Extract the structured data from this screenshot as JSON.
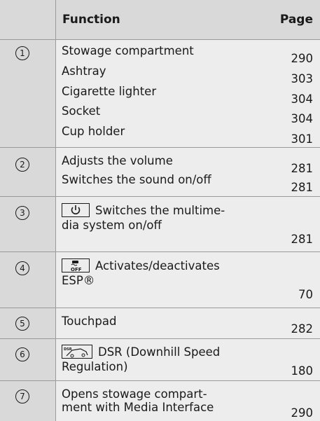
{
  "header": {
    "function": "Function",
    "page": "Page"
  },
  "sections": [
    {
      "num": "1",
      "rows": [
        {
          "text": "Stowage compartment",
          "page": "290"
        },
        {
          "text": "Ashtray",
          "page": "303"
        },
        {
          "text": "Cigarette lighter",
          "page": "304"
        },
        {
          "text": "Socket",
          "page": "304"
        },
        {
          "text": "Cup holder",
          "page": "301"
        }
      ]
    },
    {
      "num": "2",
      "rows": [
        {
          "text": "Adjusts the volume",
          "page": "281"
        },
        {
          "text": "Switches the sound on/off",
          "page": "281"
        }
      ]
    },
    {
      "num": "3",
      "line1": "Switches the multime-",
      "line2": "dia system on/off",
      "page": "281",
      "icon": "power-icon"
    },
    {
      "num": "4",
      "line1": "Activates/deactivates",
      "line2": "ESP®",
      "page": "70",
      "icon": "esp-off-icon"
    },
    {
      "num": "5",
      "text": "Touchpad",
      "page": "282"
    },
    {
      "num": "6",
      "line1": "DSR (Downhill Speed",
      "line2": "Regulation)",
      "page": "180",
      "icon": "dsr-icon"
    },
    {
      "num": "7",
      "line1": "Opens stowage compart-",
      "line2": "ment with Media Interface",
      "page": "290"
    }
  ]
}
